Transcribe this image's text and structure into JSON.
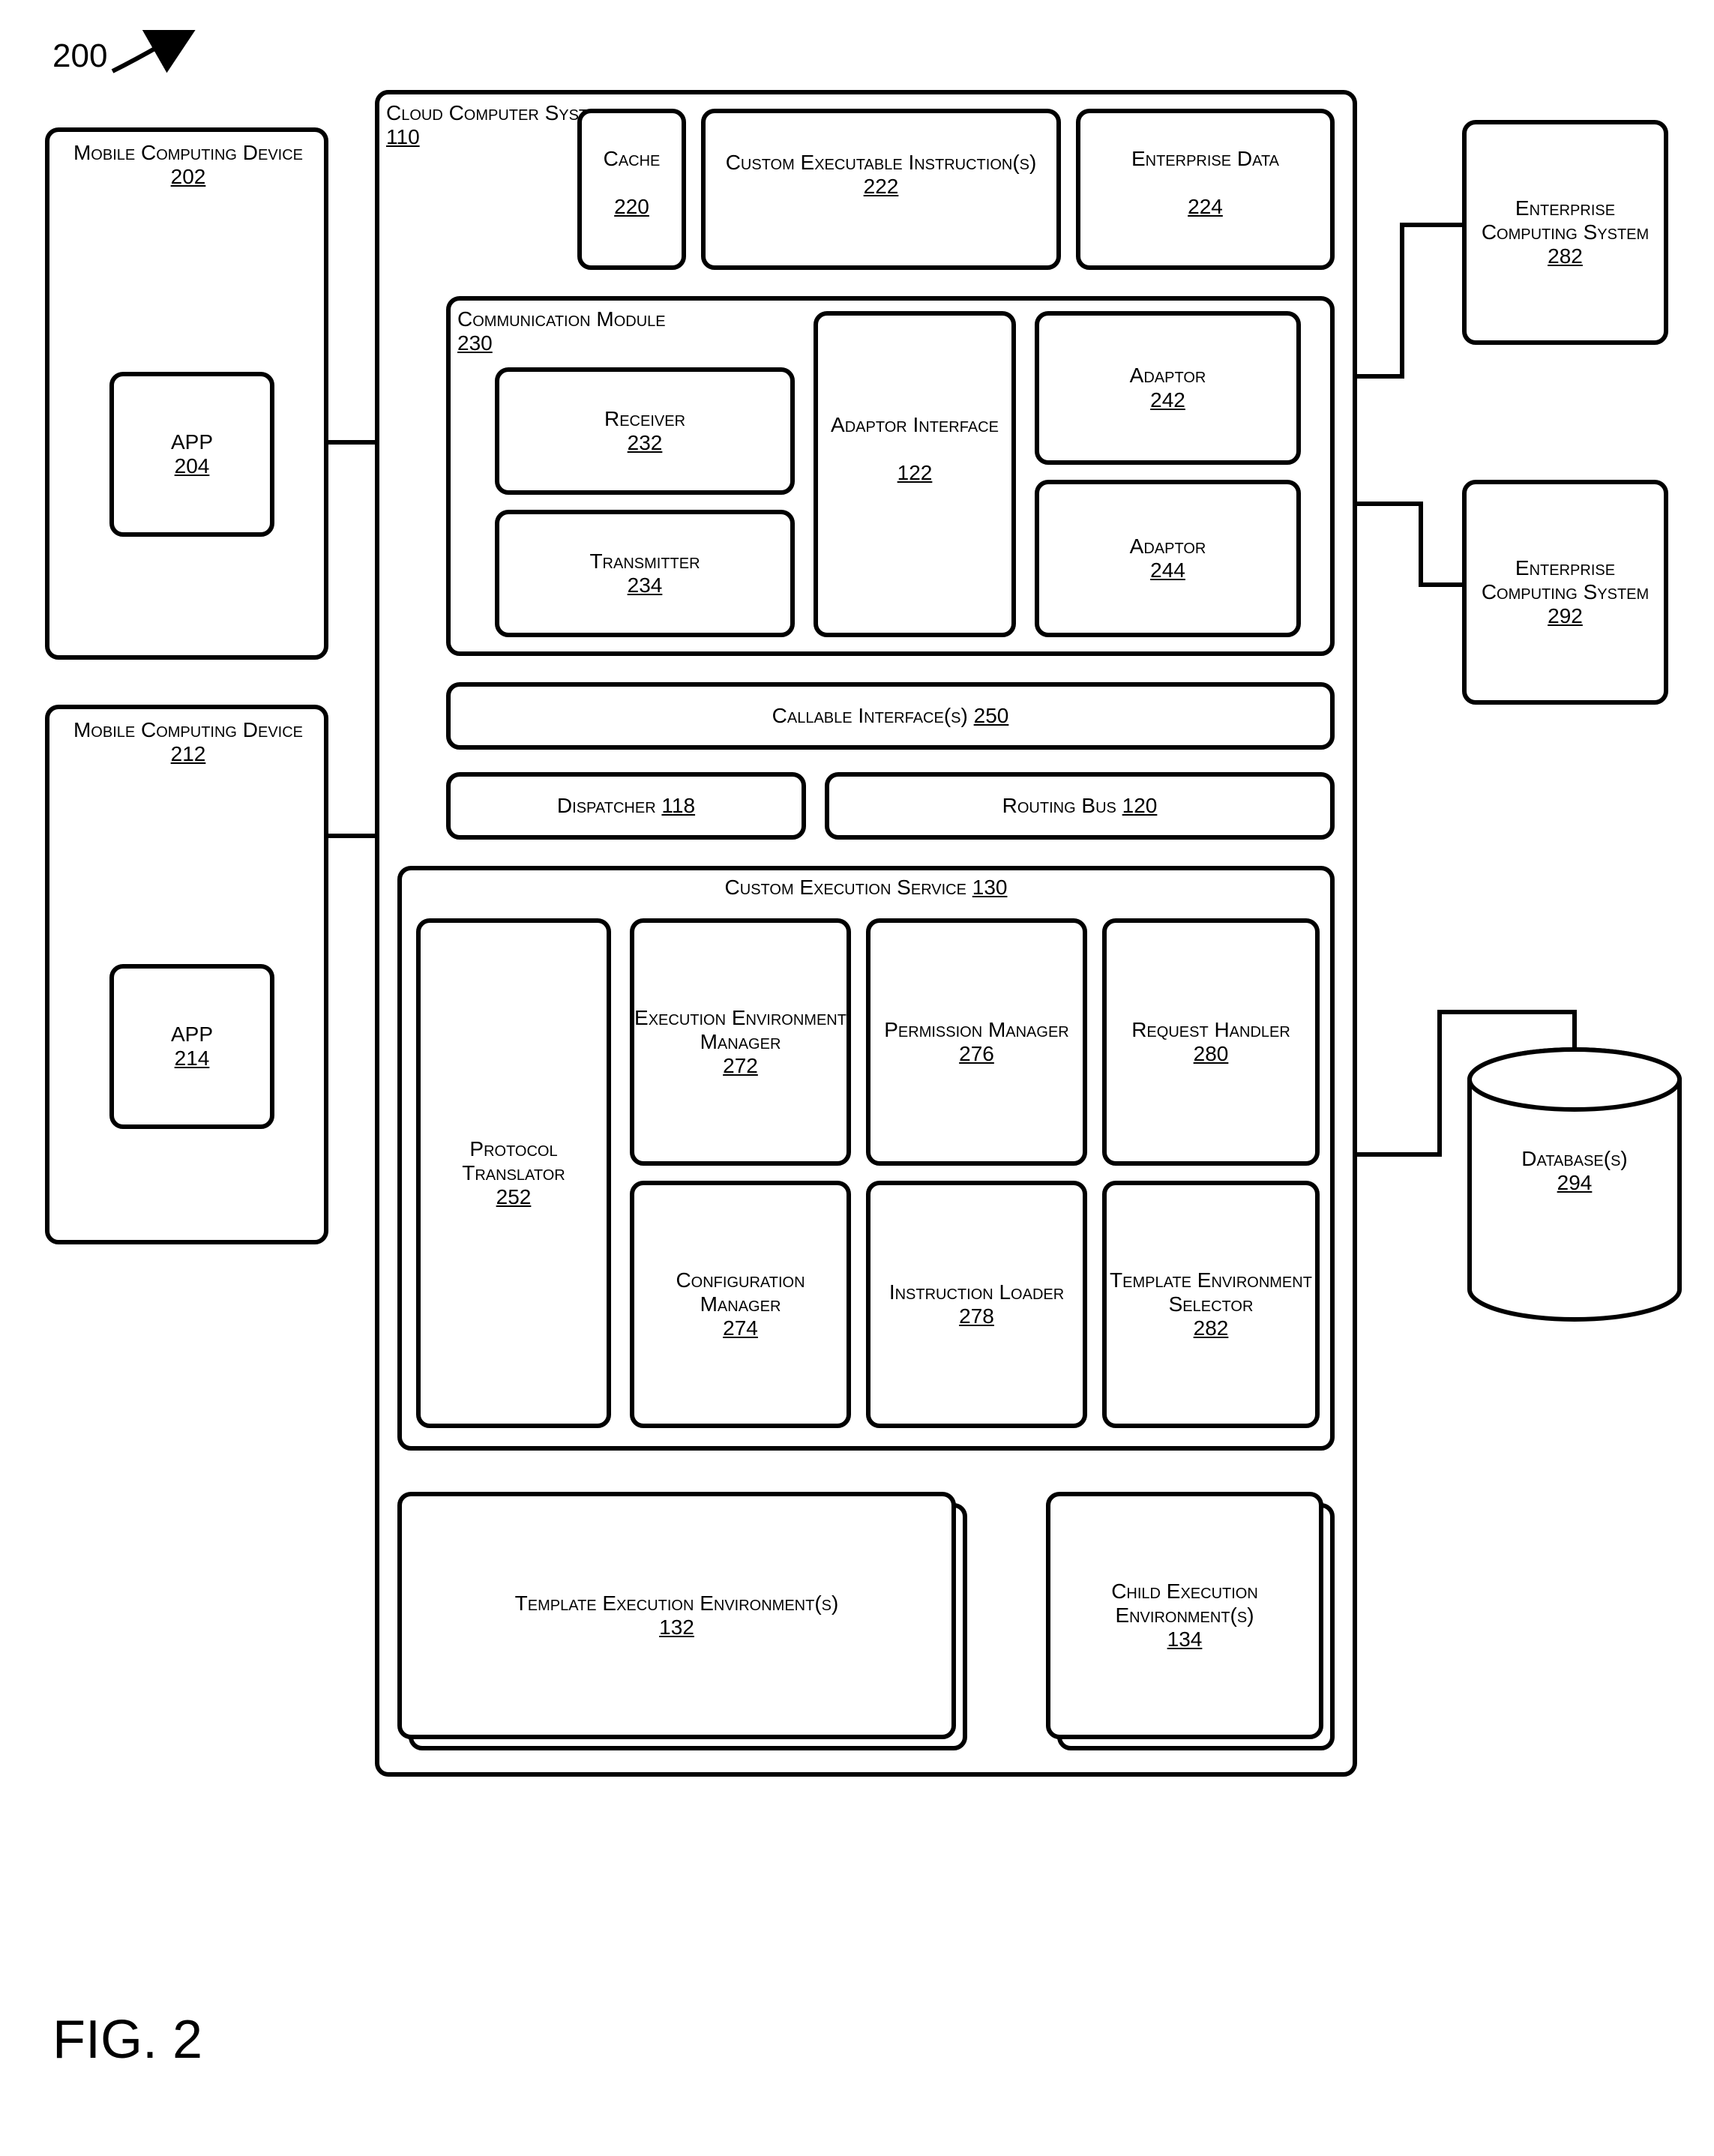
{
  "diagram_ref": "200",
  "figure_caption": "FIG. 2",
  "mobile1": {
    "title": "Mobile Computing Device",
    "num": "202",
    "app": "APP",
    "app_num": "204"
  },
  "mobile2": {
    "title": "Mobile Computing Device",
    "num": "212",
    "app": "APP",
    "app_num": "214"
  },
  "cloud": {
    "title": "Cloud Computer System",
    "num": "110"
  },
  "cache": {
    "title": "Cache",
    "num": "220"
  },
  "cei": {
    "title": "Custom Executable Instruction(s)",
    "num": "222"
  },
  "edata": {
    "title": "Enterprise Data",
    "num": "224"
  },
  "comm": {
    "title": "Communication Module",
    "num": "230"
  },
  "receiver": {
    "title": "Receiver",
    "num": "232"
  },
  "transmitter": {
    "title": "Transmitter",
    "num": "234"
  },
  "adaptor_if": {
    "title": "Adaptor Interface",
    "num": "122"
  },
  "adaptor1": {
    "title": "Adaptor",
    "num": "242"
  },
  "adaptor2": {
    "title": "Adaptor",
    "num": "244"
  },
  "callable": {
    "title": "Callable Interface(s)",
    "num": "250"
  },
  "dispatcher": {
    "title": "Dispatcher",
    "num": "118"
  },
  "routing": {
    "title": "Routing Bus",
    "num": "120"
  },
  "ces": {
    "title": "Custom Execution Service",
    "num": "130"
  },
  "protocol": {
    "title": "Protocol Translator",
    "num": "252"
  },
  "eem": {
    "title": "Execution Environment Manager",
    "num": "272"
  },
  "perm": {
    "title": "Permission Manager",
    "num": "276"
  },
  "reqh": {
    "title": "Request Handler",
    "num": "280"
  },
  "cfg": {
    "title": "Configuration Manager",
    "num": "274"
  },
  "iloader": {
    "title": "Instruction Loader",
    "num": "278"
  },
  "tes": {
    "title": "Template Environment Selector",
    "num": "282"
  },
  "tee": {
    "title": "Template Execution Environment(s)",
    "num": "132"
  },
  "cee": {
    "title": "Child Execution Environment(s)",
    "num": "134"
  },
  "ent1": {
    "title": "Enterprise Computing System",
    "num": "282"
  },
  "ent2": {
    "title": "Enterprise Computing System",
    "num": "292"
  },
  "db": {
    "title": "Database(s)",
    "num": "294"
  }
}
